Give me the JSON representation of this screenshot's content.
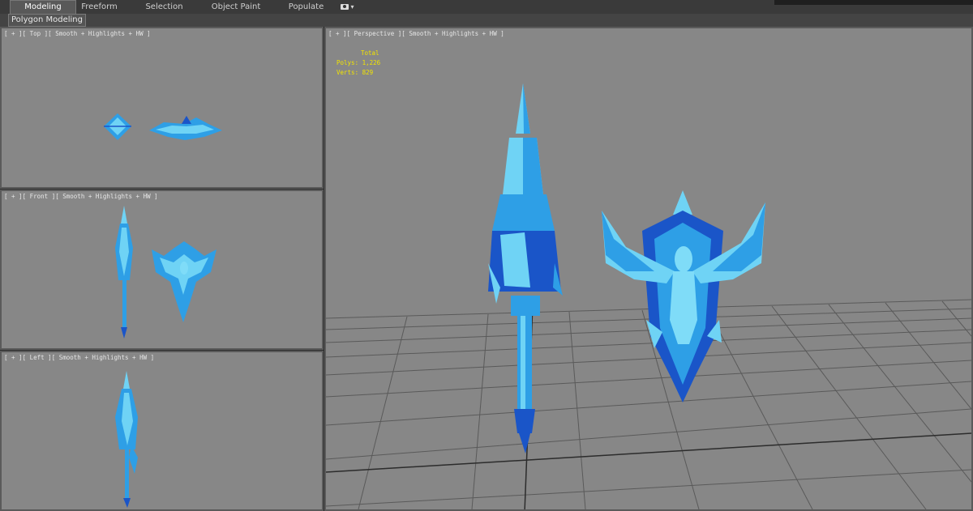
{
  "ribbon": {
    "tabs": [
      "Modeling",
      "Freeform",
      "Selection",
      "Object Paint",
      "Populate"
    ],
    "active_tab": "Modeling",
    "panel_button": "Polygon Modeling",
    "options_icon": "camera-dropdown-icon"
  },
  "viewports": {
    "top": {
      "label": "[ + ][ Top ][ Smooth + Highlights + HW ]"
    },
    "front": {
      "label": "[ + ][ Front ][ Smooth + Highlights + HW ]"
    },
    "left": {
      "label": "[ + ][ Left ][ Smooth + Highlights + HW ]"
    },
    "perspective": {
      "label": "[ + ][ Perspective ][ Smooth + Highlights + HW ]",
      "stats": {
        "total": "Total",
        "polys": "Polys: 1,226",
        "verts": "Verts: 829"
      }
    }
  },
  "colors": {
    "viewport_bg": "#878787",
    "model_light": "#6fd3f5",
    "model_mid": "#2e9fe6",
    "model_dark": "#1a55c8",
    "stats_text": "#f2e400"
  }
}
